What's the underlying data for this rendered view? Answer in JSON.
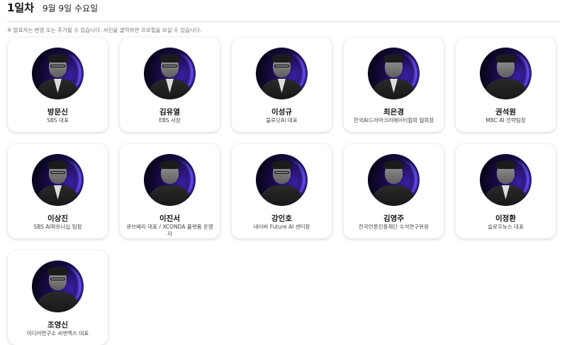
{
  "header": {
    "day_title": "1일차",
    "date": "9월 9일 수요일"
  },
  "notice": "※ 발표자는 변경 또는 추가될 수 있습니다. 사진을 클릭하면 프로필을 보실 수 있습니다.",
  "speakers": [
    {
      "name": "방문신",
      "role": "SBS 대표"
    },
    {
      "name": "김유열",
      "role": "EBS 사장"
    },
    {
      "name": "이성규",
      "role": "블루닷AI 대표"
    },
    {
      "name": "최은경",
      "role": "한국AI드라마크리에이터협회 협회장"
    },
    {
      "name": "권석원",
      "role": "MBC AI 전략팀장"
    },
    {
      "name": "이상진",
      "role": "SBS AI파트너십 팀장"
    },
    {
      "name": "이진서",
      "role": "큐브베리 대표 / XCONDA 플랫폼 운영자"
    },
    {
      "name": "강인호",
      "role": "네이버 Future AI 센터장"
    },
    {
      "name": "김영주",
      "role": "한국언론진흥재단 수석연구위원"
    },
    {
      "name": "이정환",
      "role": "슬로우뉴스 대표"
    },
    {
      "name": "조영신",
      "role": "미디어연구소 씨앤엑스 대표"
    }
  ]
}
